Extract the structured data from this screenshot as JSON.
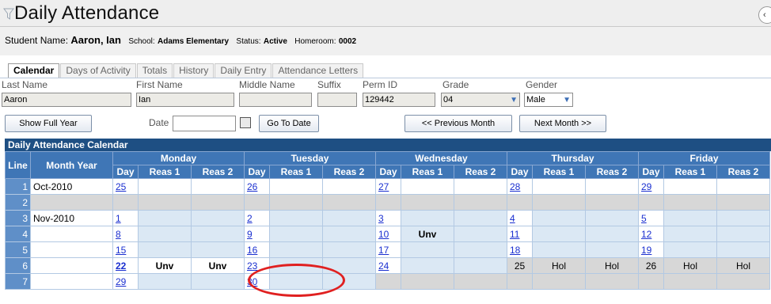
{
  "title": "Daily Attendance",
  "collapse_glyph": "‹",
  "student": {
    "name_label": "Student Name:",
    "name_value": "Aaron, Ian",
    "school_label": "School:",
    "school_value": "Adams Elementary",
    "status_label": "Status:",
    "status_value": "Active",
    "homeroom_label": "Homeroom:",
    "homeroom_value": "0002"
  },
  "tabs": [
    "Calendar",
    "Days of Activity",
    "Totals",
    "History",
    "Daily Entry",
    "Attendance Letters"
  ],
  "fields": {
    "last_name": {
      "label": "Last Name",
      "value": "Aaron"
    },
    "first_name": {
      "label": "First Name",
      "value": "Ian"
    },
    "middle_name": {
      "label": "Middle Name",
      "value": ""
    },
    "suffix": {
      "label": "Suffix",
      "value": ""
    },
    "perm_id": {
      "label": "Perm ID",
      "value": "129442"
    },
    "grade": {
      "label": "Grade",
      "value": "04"
    },
    "gender": {
      "label": "Gender",
      "value": "Male"
    }
  },
  "buttons": {
    "show_full_year": "Show Full Year",
    "date_label": "Date",
    "go_to_date": "Go To Date",
    "previous_month": "<< Previous Month",
    "next_month": "Next Month >>"
  },
  "calendar": {
    "header": "Daily Attendance Calendar",
    "col_line": "Line",
    "col_month_year": "Month Year",
    "weekdays": [
      "Monday",
      "Tuesday",
      "Wednesday",
      "Thursday",
      "Friday"
    ],
    "sub_headers": [
      "Day",
      "Reas 1",
      "Reas 2"
    ],
    "rows": [
      {
        "line": "1",
        "month": "Oct-2010",
        "days": [
          [
            "25",
            "",
            ""
          ],
          [
            "26",
            "",
            ""
          ],
          [
            "27",
            "",
            ""
          ],
          [
            "28",
            "",
            ""
          ],
          [
            "29",
            "",
            ""
          ]
        ]
      },
      {
        "line": "2",
        "month": "",
        "days": [
          [
            "",
            "",
            ""
          ],
          [
            "",
            "",
            ""
          ],
          [
            "",
            "",
            ""
          ],
          [
            "",
            "",
            ""
          ],
          [
            "",
            "",
            ""
          ]
        ]
      },
      {
        "line": "3",
        "month": "Nov-2010",
        "days": [
          [
            "1",
            "",
            ""
          ],
          [
            "2",
            "",
            ""
          ],
          [
            "3",
            "",
            ""
          ],
          [
            "4",
            "",
            ""
          ],
          [
            "5",
            "",
            ""
          ]
        ]
      },
      {
        "line": "4",
        "month": "",
        "days": [
          [
            "8",
            "",
            ""
          ],
          [
            "9",
            "",
            ""
          ],
          [
            "10",
            "Unv",
            ""
          ],
          [
            "11",
            "",
            ""
          ],
          [
            "12",
            "",
            ""
          ]
        ]
      },
      {
        "line": "5",
        "month": "",
        "days": [
          [
            "15",
            "",
            ""
          ],
          [
            "16",
            "",
            ""
          ],
          [
            "17",
            "",
            ""
          ],
          [
            "18",
            "",
            ""
          ],
          [
            "19",
            "",
            ""
          ]
        ]
      },
      {
        "line": "6",
        "month": "",
        "days": [
          [
            "22",
            "Unv",
            "Unv"
          ],
          [
            "23",
            "",
            ""
          ],
          [
            "24",
            "",
            ""
          ],
          [
            "25",
            "Hol",
            "Hol"
          ],
          [
            "26",
            "Hol",
            "Hol"
          ]
        ]
      },
      {
        "line": "7",
        "month": "",
        "days": [
          [
            "29",
            "",
            ""
          ],
          [
            "30",
            "",
            ""
          ],
          [
            "",
            "",
            ""
          ],
          [
            "",
            "",
            ""
          ],
          [
            "",
            "",
            ""
          ]
        ]
      }
    ]
  },
  "colors": {
    "header_navy": "#1e4f83",
    "column_header_blue": "#3f76b6",
    "cell_light_blue": "#dbe8f4",
    "link_blue": "#1a2fd0",
    "annotation_red": "#e02020"
  }
}
